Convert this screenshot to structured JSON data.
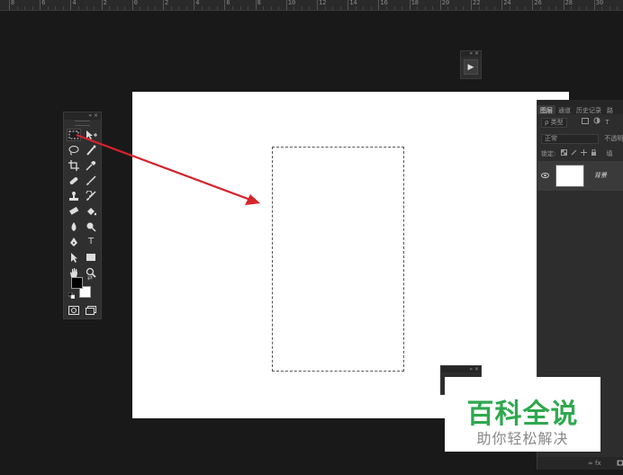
{
  "ruler": {
    "labels": [
      "8",
      "6",
      "4",
      "2",
      "0",
      "2",
      "4",
      "6",
      "8",
      "10",
      "12",
      "14",
      "16",
      "18",
      "20",
      "22",
      "24",
      "26",
      "28",
      "30"
    ]
  },
  "mini_panel": {
    "close": "« ×",
    "play_icon": "▶"
  },
  "toolbar": {
    "header": "« ×",
    "text_tool": "T",
    "arrows": "⇄"
  },
  "layers": {
    "tabs": [
      "图层",
      "通道",
      "历史记录",
      "路"
    ],
    "filter_kind": "ρ 类型",
    "blend_mode": "正常",
    "opacity_label": "不透明",
    "lock_label": "锁定:",
    "fill_label": "填",
    "layer_name": "背景",
    "bottom": "∞  fx"
  },
  "small_panel": {
    "close": "« ×"
  },
  "watermark": {
    "title": "百科全说",
    "subtitle": "助你轻松解决"
  },
  "colors": {
    "arrow": "#d6232b",
    "watermark_green": "#2fa84f",
    "background": "#191919"
  }
}
